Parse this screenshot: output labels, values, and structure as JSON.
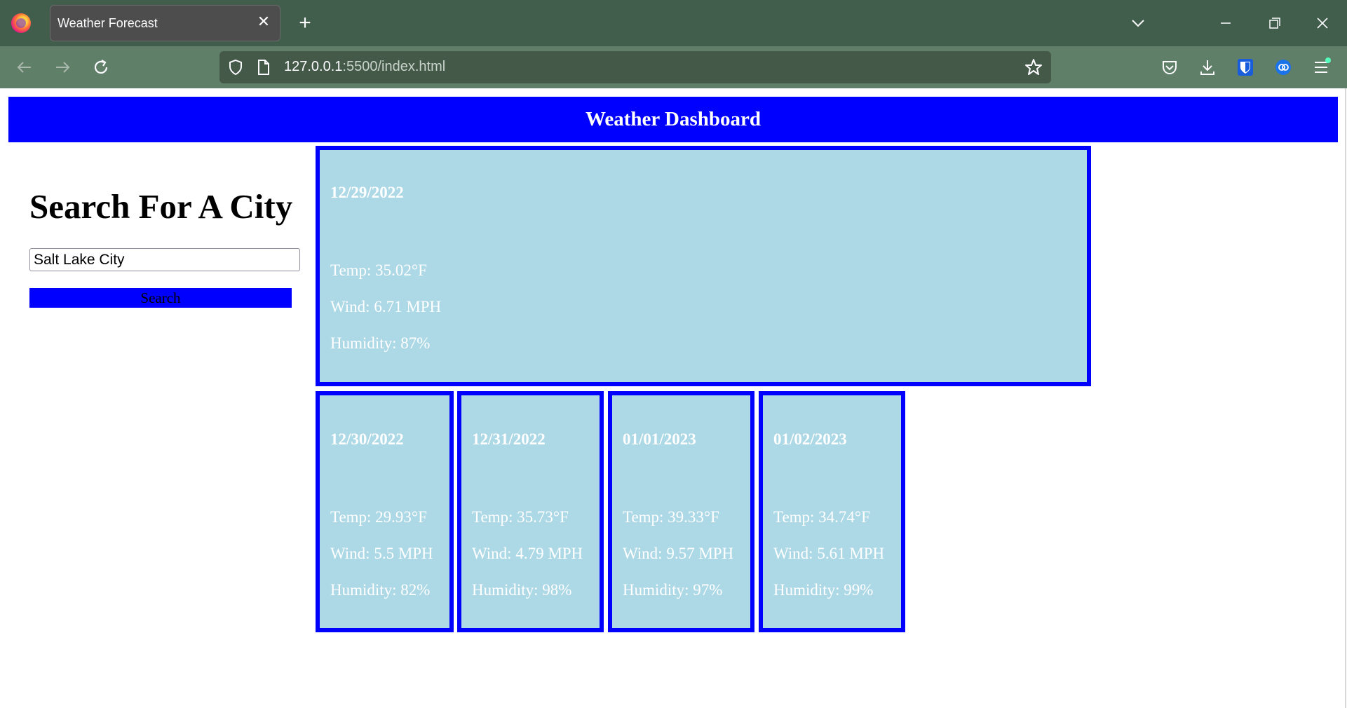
{
  "browser": {
    "tab_title": "Weather Forecast",
    "url_host": "127.0.0.1",
    "url_rest": ":5500/index.html"
  },
  "page": {
    "header_title": "Weather Dashboard",
    "search": {
      "heading": "Search For A City",
      "input_value": "Salt Lake City",
      "button_label": "Search"
    },
    "today": {
      "date": "12/29/2022",
      "temp": "Temp: 35.02°F",
      "wind": "Wind: 6.71 MPH",
      "humidity": "Humidity: 87%"
    },
    "forecast": [
      {
        "date": "12/30/2022",
        "temp": "Temp: 29.93°F",
        "wind": "Wind: 5.5 MPH",
        "humidity": "Humidity: 82%"
      },
      {
        "date": "12/31/2022",
        "temp": "Temp: 35.73°F",
        "wind": "Wind: 4.79 MPH",
        "humidity": "Humidity: 98%"
      },
      {
        "date": "01/01/2023",
        "temp": "Temp: 39.33°F",
        "wind": "Wind: 9.57 MPH",
        "humidity": "Humidity: 97%"
      },
      {
        "date": "01/02/2023",
        "temp": "Temp: 34.74°F",
        "wind": "Wind: 5.61 MPH",
        "humidity": "Humidity: 99%"
      }
    ]
  },
  "colors": {
    "tabbar": "#415d4b",
    "navbar": "#607f69",
    "header_bg": "#0000ff",
    "card_bg": "#add8e6",
    "card_border": "#0000ff"
  }
}
